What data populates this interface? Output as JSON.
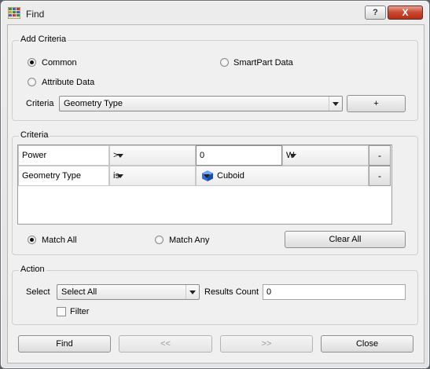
{
  "window": {
    "title": "Find",
    "help_glyph": "?",
    "close_glyph": "X"
  },
  "add_criteria": {
    "title": "Add Criteria",
    "radio_common": "Common",
    "radio_smartpart": "SmartPart Data",
    "radio_attribute": "Attribute Data",
    "selected": "Common",
    "criteria_label": "Criteria",
    "criteria_value": "Geometry Type",
    "add_button": "+"
  },
  "criteria": {
    "title": "Criteria",
    "rows": [
      {
        "field": "Power",
        "operator": ">",
        "value": "0",
        "unit": "W",
        "remove": "-"
      },
      {
        "field": "Geometry Type",
        "operator": "is",
        "value": "Cuboid",
        "value_icon": "cube-icon",
        "remove": "-"
      }
    ],
    "match_all": "Match All",
    "match_any": "Match Any",
    "match_selected": "Match All",
    "clear_all": "Clear All"
  },
  "action": {
    "title": "Action",
    "select_label": "Select",
    "select_value": "Select All",
    "results_count_label": "Results Count",
    "results_count_value": "0",
    "filter_label": "Filter",
    "filter_checked": false
  },
  "footer": {
    "find": "Find",
    "prev": "<<",
    "next": ">>",
    "close": "Close"
  },
  "colors": {
    "cube": "#2d6fdc",
    "close_button": "#c9462f"
  }
}
